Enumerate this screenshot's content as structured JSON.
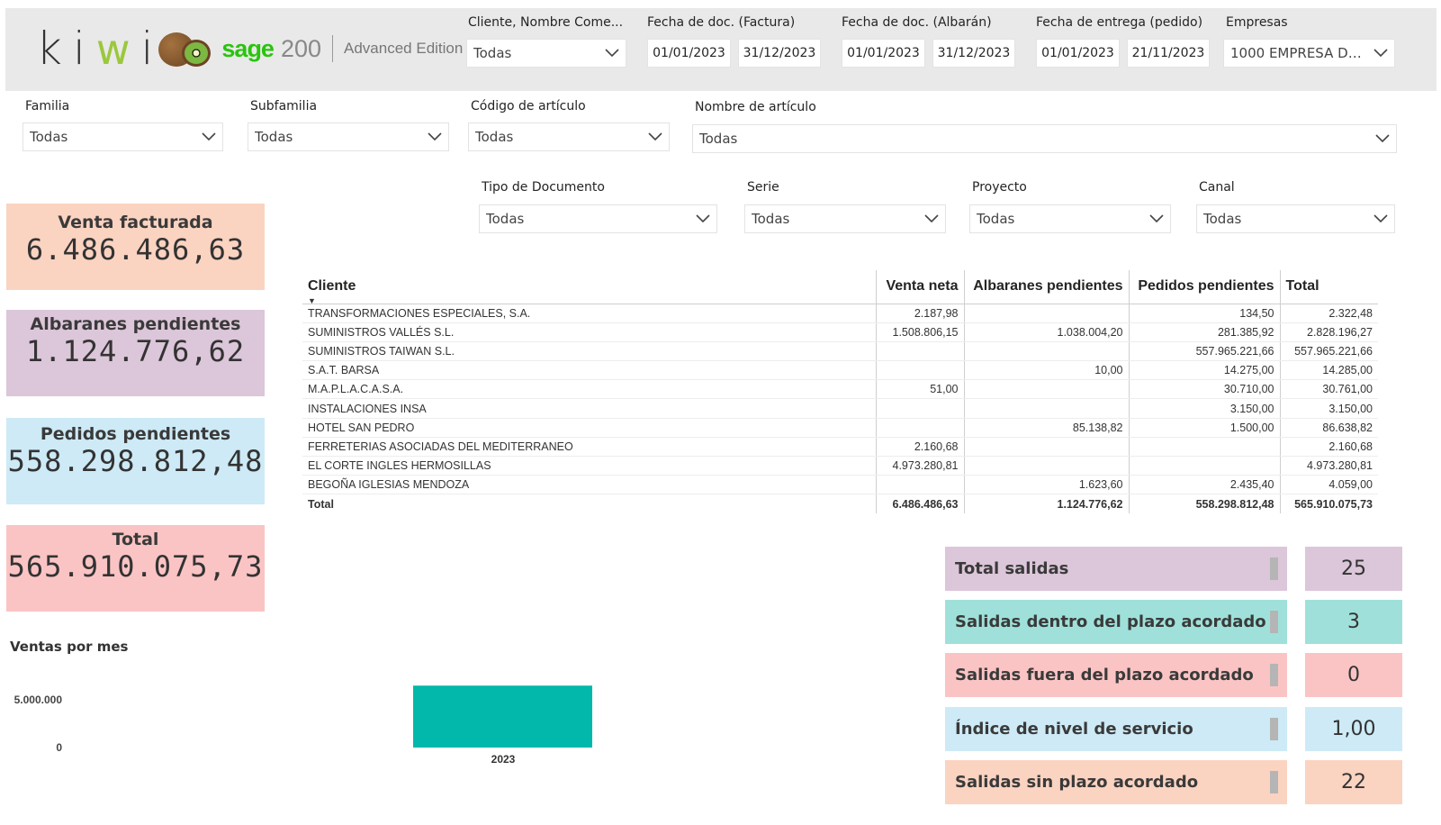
{
  "header": {
    "logo": {
      "kiwi_k": "k",
      "kiwi_i1": "i",
      "kiwi_w": "w",
      "kiwi_i2": "i",
      "sage": "sage",
      "sage_num": "200",
      "edition": "Advanced Edition"
    },
    "filters": {
      "cliente": {
        "label": "Cliente, Nombre Come...",
        "value": "Todas"
      },
      "fecha_factura": {
        "label": "Fecha de doc. (Factura)",
        "from": "01/01/2023",
        "to": "31/12/2023"
      },
      "fecha_albaran": {
        "label": "Fecha de doc. (Albarán)",
        "from": "01/01/2023",
        "to": "31/12/2023"
      },
      "fecha_entrega": {
        "label": "Fecha de entrega (pedido)",
        "from": "01/01/2023",
        "to": "21/11/2023"
      },
      "empresas": {
        "label": "Empresas",
        "value": "1000 EMPRESA DE..."
      }
    }
  },
  "filters_row2": {
    "familia": {
      "label": "Familia",
      "value": "Todas"
    },
    "subfamilia": {
      "label": "Subfamilia",
      "value": "Todas"
    },
    "codigo": {
      "label": "Código de artículo",
      "value": "Todas"
    },
    "nombre": {
      "label": "Nombre de artículo",
      "value": "Todas"
    }
  },
  "filters_row3": {
    "tipo": {
      "label": "Tipo de Documento",
      "value": "Todas"
    },
    "serie": {
      "label": "Serie",
      "value": "Todas"
    },
    "proyecto": {
      "label": "Proyecto",
      "value": "Todas"
    },
    "canal": {
      "label": "Canal",
      "value": "Todas"
    }
  },
  "kpis": {
    "venta": {
      "label": "Venta facturada",
      "value": "6.486.486,63",
      "color": "#fbd3c1"
    },
    "albaranes": {
      "label": "Albaranes pendientes",
      "value": "1.124.776,62",
      "color": "#dcc6d9"
    },
    "pedidos": {
      "label": "Pedidos pendientes",
      "value": "558.298.812,48",
      "color": "#cdeaf6"
    },
    "total": {
      "label": "Total",
      "value": "565.910.075,73",
      "color": "#fbc4c4"
    }
  },
  "table": {
    "headers": {
      "cliente": "Cliente",
      "venta": "Venta neta",
      "albaranes": "Albaranes pendientes",
      "pedidos": "Pedidos pendientes",
      "total": "Total"
    },
    "rows": [
      {
        "cliente": "TRANSFORMACIONES ESPECIALES, S.A.",
        "venta": "2.187,98",
        "albaranes": "",
        "pedidos": "134,50",
        "total": "2.322,48"
      },
      {
        "cliente": "SUMINISTROS VALLÉS S.L.",
        "venta": "1.508.806,15",
        "albaranes": "1.038.004,20",
        "pedidos": "281.385,92",
        "total": "2.828.196,27"
      },
      {
        "cliente": "SUMINISTROS TAIWAN S.L.",
        "venta": "",
        "albaranes": "",
        "pedidos": "557.965.221,66",
        "total": "557.965.221,66"
      },
      {
        "cliente": "S.A.T. BARSA",
        "venta": "",
        "albaranes": "10,00",
        "pedidos": "14.275,00",
        "total": "14.285,00"
      },
      {
        "cliente": "M.A.P.L.A.C.A.S.A.",
        "venta": "51,00",
        "albaranes": "",
        "pedidos": "30.710,00",
        "total": "30.761,00"
      },
      {
        "cliente": "INSTALACIONES INSA",
        "venta": "",
        "albaranes": "",
        "pedidos": "3.150,00",
        "total": "3.150,00"
      },
      {
        "cliente": "HOTEL SAN PEDRO",
        "venta": "",
        "albaranes": "85.138,82",
        "pedidos": "1.500,00",
        "total": "86.638,82"
      },
      {
        "cliente": "FERRETERIAS ASOCIADAS DEL MEDITERRANEO",
        "venta": "2.160,68",
        "albaranes": "",
        "pedidos": "",
        "total": "2.160,68"
      },
      {
        "cliente": "EL CORTE INGLES HERMOSILLAS",
        "venta": "4.973.280,81",
        "albaranes": "",
        "pedidos": "",
        "total": "4.973.280,81"
      },
      {
        "cliente": "BEGOÑA IGLESIAS MENDOZA",
        "venta": "",
        "albaranes": "1.623,60",
        "pedidos": "2.435,40",
        "total": "4.059,00"
      }
    ],
    "total_row": {
      "cliente": "Total",
      "venta": "6.486.486,63",
      "albaranes": "1.124.776,62",
      "pedidos": "558.298.812,48",
      "total": "565.910.075,73"
    }
  },
  "stats": [
    {
      "label": "Total salidas",
      "value": "25",
      "color": "#dcc6d9"
    },
    {
      "label": "Salidas dentro del plazo acordado",
      "value": "3",
      "color": "#9fe1da"
    },
    {
      "label": "Salidas fuera del plazo acordado",
      "value": "0",
      "color": "#fbc4c4"
    },
    {
      "label": "Índice de nivel de servicio",
      "value": "1,00",
      "color": "#cdeaf6"
    },
    {
      "label": "Salidas sin plazo acordado",
      "value": "22",
      "color": "#fbd3c1"
    }
  ],
  "chart_data": {
    "type": "bar",
    "title": "Ventas por mes",
    "categories": [
      "2023"
    ],
    "values": [
      6486486.63
    ],
    "ytick_labels": [
      "5.000.000",
      "0"
    ],
    "yticks": [
      5000000,
      0
    ],
    "ylim": [
      0,
      5000000
    ],
    "bar_color": "#01b8aa"
  },
  "icons": {
    "dropdown": "chevron-down-icon",
    "sort": "sort-desc-icon"
  }
}
